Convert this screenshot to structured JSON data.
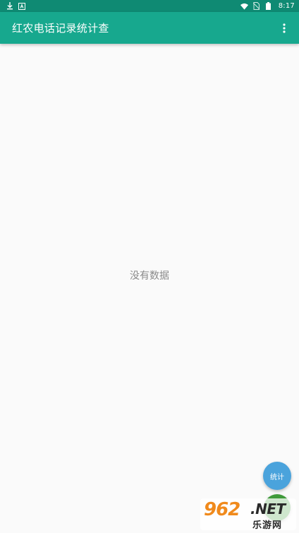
{
  "status_bar": {
    "time": "8:17",
    "icons": [
      "download-icon",
      "a-badge-icon",
      "wifi-icon",
      "no-sim-icon",
      "battery-icon"
    ]
  },
  "app_bar": {
    "title": "红农电话记录统计查",
    "menu_icon": "more-vert-icon"
  },
  "content": {
    "empty_text": "没有数据"
  },
  "fab": {
    "label": "统计",
    "color": "#4aa3dc"
  },
  "watermark": {
    "number": "962",
    "suffix": ".NET",
    "subtitle": "乐游网"
  },
  "colors": {
    "status_bar": "#0f8a73",
    "app_bar": "#17a88e",
    "background": "#fafafa"
  }
}
